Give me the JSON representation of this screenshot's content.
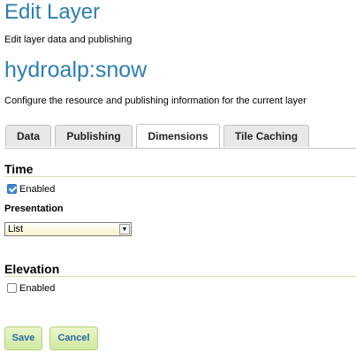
{
  "header": {
    "title": "Edit Layer",
    "subtitle": "Edit layer data and publishing"
  },
  "layer": {
    "name": "hydroalp:snow",
    "description": "Configure the resource and publishing information for the current layer"
  },
  "tabs": [
    {
      "label": "Data",
      "active": false
    },
    {
      "label": "Publishing",
      "active": false
    },
    {
      "label": "Dimensions",
      "active": true
    },
    {
      "label": "Tile Caching",
      "active": false
    }
  ],
  "time": {
    "title": "Time",
    "enabled_label": "Enabled",
    "enabled": true,
    "presentation_label": "Presentation",
    "presentation_value": "List"
  },
  "elevation": {
    "title": "Elevation",
    "enabled_label": "Enabled",
    "enabled": false
  },
  "actions": {
    "save_label": "Save",
    "cancel_label": "Cancel"
  },
  "colors": {
    "heading": "#2b7fb3",
    "button_bg": "#d8eeb0",
    "button_text": "#2b6aa5",
    "section_rule": "#cfe3a8"
  },
  "icons": {
    "checkbox_checked": "checkbox-checked-icon",
    "dropdown_arrow": "chevron-down-icon"
  }
}
